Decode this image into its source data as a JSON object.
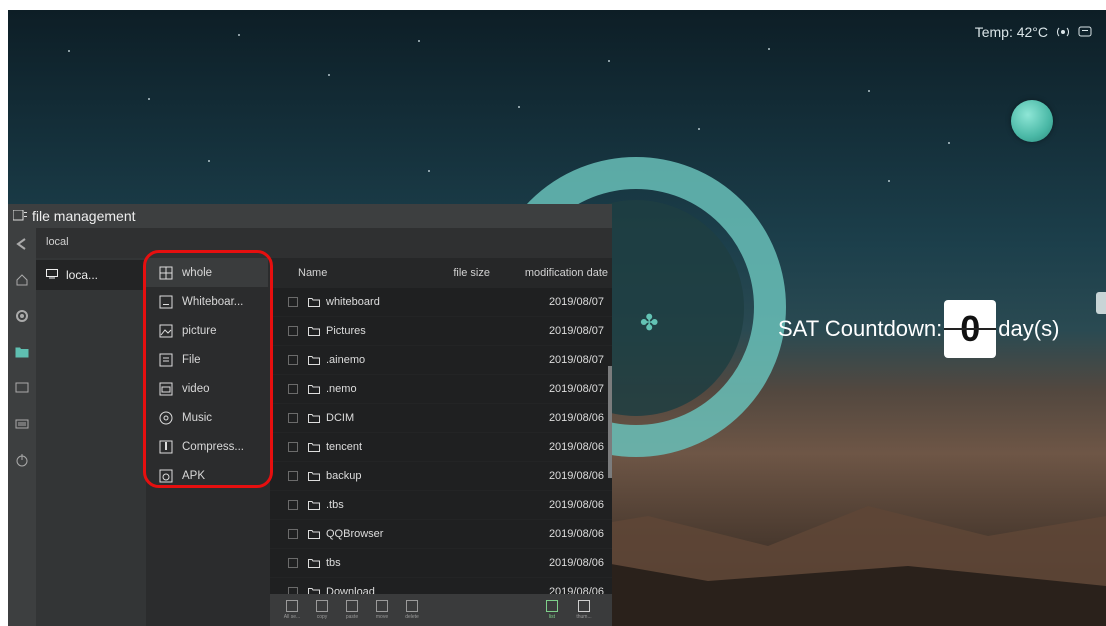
{
  "status": {
    "temp": "Temp:  42°C",
    "icons": [
      "wifi-hotspot-icon",
      "chat-icon"
    ]
  },
  "countdown": {
    "label": "SAT Countdown:",
    "digits": "0",
    "unit": "day(s)"
  },
  "window": {
    "title": "file management",
    "breadcrumb": "local",
    "storage": {
      "label": "loca...",
      "icon": "monitor-icon"
    },
    "categories": [
      {
        "label": "whole",
        "icon": "grid-icon"
      },
      {
        "label": "Whiteboar...",
        "icon": "whiteboard-icon"
      },
      {
        "label": "picture",
        "icon": "picture-icon"
      },
      {
        "label": "File",
        "icon": "document-icon"
      },
      {
        "label": "video",
        "icon": "video-icon"
      },
      {
        "label": "Music",
        "icon": "music-icon"
      },
      {
        "label": "Compress...",
        "icon": "archive-icon"
      },
      {
        "label": "APK",
        "icon": "apk-icon"
      }
    ],
    "columns": {
      "name": "Name",
      "size": "file size",
      "date": "modification date"
    },
    "files": [
      {
        "name": "whiteboard",
        "date": "2019/08/07"
      },
      {
        "name": "Pictures",
        "date": "2019/08/07"
      },
      {
        "name": ".ainemo",
        "date": "2019/08/07"
      },
      {
        "name": ".nemo",
        "date": "2019/08/07"
      },
      {
        "name": "DCIM",
        "date": "2019/08/06"
      },
      {
        "name": "tencent",
        "date": "2019/08/06"
      },
      {
        "name": "backup",
        "date": "2019/08/06"
      },
      {
        "name": ".tbs",
        "date": "2019/08/06"
      },
      {
        "name": "QQBrowser",
        "date": "2019/08/06"
      },
      {
        "name": "tbs",
        "date": "2019/08/06"
      },
      {
        "name": "Download",
        "date": "2019/08/06"
      }
    ],
    "toolbar": [
      {
        "label": "All se...",
        "icon": "select-all-icon"
      },
      {
        "label": "copy",
        "icon": "copy-icon"
      },
      {
        "label": "paste",
        "icon": "paste-icon"
      },
      {
        "label": "move",
        "icon": "move-icon"
      },
      {
        "label": "delete",
        "icon": "delete-icon"
      }
    ],
    "view_modes": [
      {
        "label": "list",
        "icon": "list-view-icon",
        "selected": true
      },
      {
        "label": "thum...",
        "icon": "thumbnail-view-icon",
        "selected": false
      }
    ]
  },
  "dock_icons": [
    "back-icon",
    "home-icon",
    "settings-icon",
    "folder-icon",
    "screen-icon",
    "keyboard-icon",
    "power-icon"
  ],
  "colors": {
    "accent": "#68bfb8",
    "highlight": "#e60f0f",
    "selected_view": "#7ecf8a"
  }
}
